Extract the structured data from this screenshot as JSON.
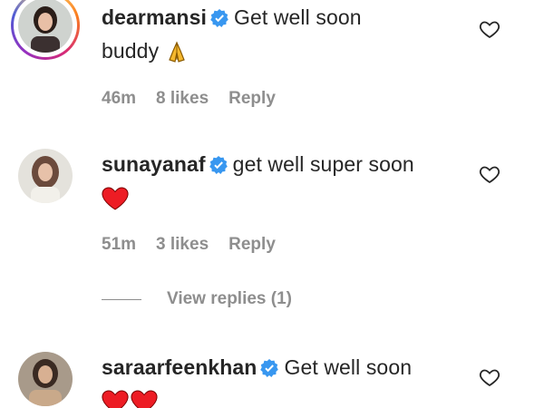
{
  "comments": [
    {
      "username": "dearmansi",
      "verified": true,
      "text": "Get well soon",
      "text_line2": "buddy",
      "emoji": "praying-hands",
      "time": "46m",
      "likes": "8 likes",
      "reply": "Reply",
      "avatar_ring": "story"
    },
    {
      "username": "sunayanaf",
      "verified": true,
      "text": "get well super soon",
      "emoji": "red-heart",
      "time": "51m",
      "likes": "3 likes",
      "reply": "Reply",
      "view_replies": "View replies (1)"
    },
    {
      "username": "saraarfeenkhan",
      "verified": true,
      "text": "Get well soon",
      "emoji": "two-red-hearts"
    }
  ],
  "colors": {
    "verified": "#3897f0",
    "heart": "#ed1c24",
    "meta": "#8e8e8e",
    "text": "#262626"
  }
}
